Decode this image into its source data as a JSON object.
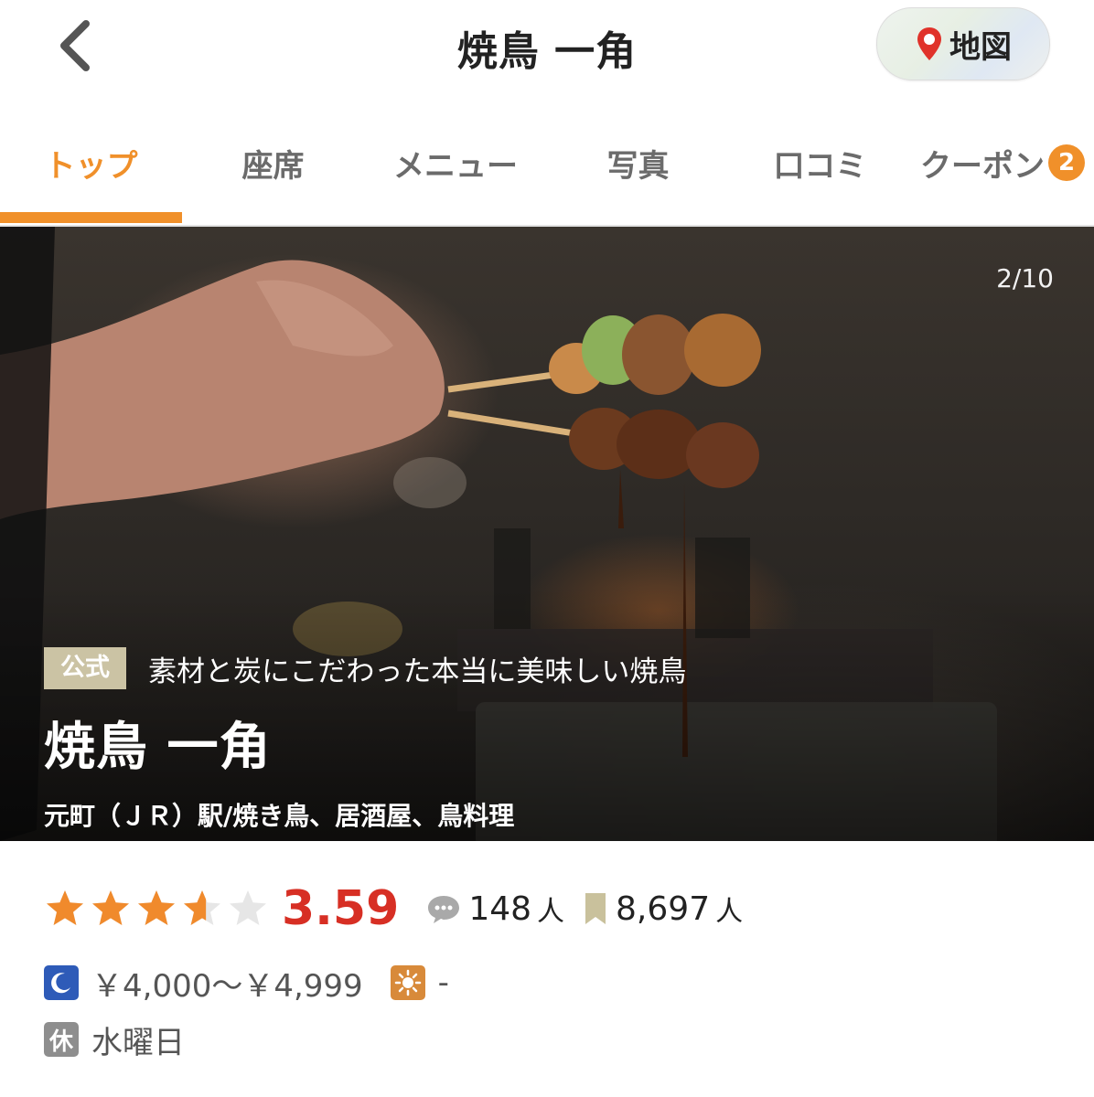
{
  "header": {
    "title": "焼鳥 一角",
    "map_label": "地図"
  },
  "tabs": [
    {
      "label": "トップ",
      "active": true
    },
    {
      "label": "座席"
    },
    {
      "label": "メニュー"
    },
    {
      "label": "写真"
    },
    {
      "label": "口コミ"
    },
    {
      "label": "クーポン",
      "badge": "2"
    }
  ],
  "hero": {
    "counter": "2/10",
    "official_label": "公式",
    "catchphrase": "素材と炭にこだわった本当に美味しい焼鳥",
    "name": "焼鳥 一角",
    "area_genre": "元町（ＪＲ）駅/焼き鳥、居酒屋、鳥料理"
  },
  "rating": {
    "score": "3.59",
    "stars_value": 3.59,
    "reviews": "148",
    "reviews_unit": "人",
    "saves": "8,697",
    "saves_unit": "人"
  },
  "price": {
    "dinner": "￥4,000～￥4,999",
    "lunch": "-"
  },
  "holiday": {
    "label": "休",
    "value": "水曜日"
  },
  "colors": {
    "accent": "#f0902a",
    "score": "#d72f24",
    "star": "#f08a2c",
    "dinner_icon": "#2e5bb8",
    "lunch_icon": "#d88a3a"
  }
}
